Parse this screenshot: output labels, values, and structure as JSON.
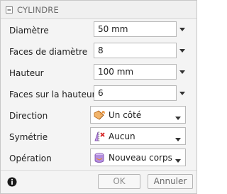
{
  "dialog": {
    "title": "CYLINDRE"
  },
  "fields": [
    {
      "label": "Diamètre",
      "value": "50 mm"
    },
    {
      "label": "Faces de diamètre",
      "value": "8"
    },
    {
      "label": "Hauteur",
      "value": "100 mm"
    },
    {
      "label": "Faces sur la hauteur",
      "value": "6"
    }
  ],
  "selects": [
    {
      "label": "Direction",
      "value": "Un côté",
      "icon": "one-side-direction-icon"
    },
    {
      "label": "Symétrie",
      "value": "Aucun",
      "icon": "symmetry-none-icon"
    },
    {
      "label": "Opération",
      "value": "Nouveau corps",
      "icon": "new-body-icon"
    }
  ],
  "footer": {
    "ok_label": "OK",
    "cancel_label": "Annuler",
    "info_icon": "info-icon"
  },
  "colors": {
    "panel_bg": "#f4f4f4",
    "field_border": "#b9b9b9",
    "text": "#202020",
    "icon_accent_orange": "#e8892a",
    "icon_accent_red": "#d42020",
    "icon_accent_purple": "#8a5cc8"
  }
}
